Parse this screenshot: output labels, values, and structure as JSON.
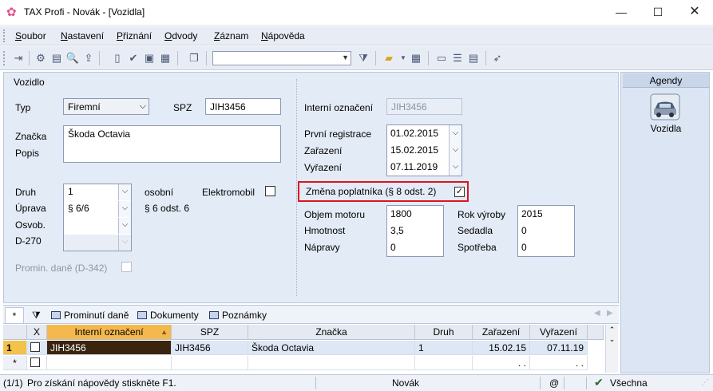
{
  "window": {
    "title": "TAX Profi - Novák - [Vozidla]",
    "icon": "flower-app-icon",
    "controls": [
      "minimize-icon",
      "maximize-icon",
      "close-icon"
    ]
  },
  "menu": [
    {
      "label": "Soubor",
      "mnemonic": "S",
      "rest": "oubor"
    },
    {
      "label": "Nastavení",
      "mnemonic": "N",
      "rest": "astavení"
    },
    {
      "label": "Přiznání",
      "mnemonic": "P",
      "rest": "řiznání"
    },
    {
      "label": "Odvody",
      "mnemonic": "O",
      "rest": "dvody"
    },
    {
      "label": "Záznam",
      "mnemonic": "Z",
      "rest": "áznam"
    },
    {
      "label": "Nápověda",
      "mnemonic": "N",
      "rest": "ápověda"
    }
  ],
  "toolbar": {
    "search_value": ""
  },
  "form": {
    "section_title": "Vozidlo",
    "typ_label": "Typ",
    "typ_value": "Firemní",
    "spz_label": "SPZ",
    "spz_value": "JIH3456",
    "znacka_label": "Značka",
    "znacka_value": "Škoda Octavia",
    "popis_label": "Popis",
    "druh_label": "Druh",
    "druh_value": "1",
    "druh_desc": "osobní",
    "uprava_label": "Úprava",
    "uprava_value": "§ 6/6",
    "uprava_desc": "§ 6 odst. 6",
    "osvob_label": "Osvob.",
    "osvob_value": "",
    "d270_label": "D-270",
    "d270_value": "",
    "elektromobil_label": "Elektromobil",
    "elektromobil_checked": false,
    "promin_label": "Promin. daně (D-342)",
    "promin_checked": false,
    "interni_label": "Interní označení",
    "interni_value": "JIH3456",
    "prvni_reg_label": "První registrace",
    "prvni_reg_value": "01.02.2015",
    "zarazeni_label": "Zařazení",
    "zarazeni_value": "15.02.2015",
    "vyrazeni_label": "Vyřazení",
    "vyrazeni_value": "07.11.2019",
    "zmena_label": "Změna poplatníka (§ 8 odst. 2)",
    "zmena_checked": true,
    "zmena_mark": "✓",
    "objem_label": "Objem motoru",
    "objem_value": "1800",
    "hmotnost_label": "Hmotnost",
    "hmotnost_value": "3,5",
    "napravy_label": "Nápravy",
    "napravy_value": "0",
    "rok_label": "Rok výroby",
    "rok_value": "2015",
    "sedadla_label": "Sedadla",
    "sedadla_value": "0",
    "spotreba_label": "Spotřeba",
    "spotreba_value": "0",
    "highlight_color": "#e0141e"
  },
  "agendy": {
    "header": "Agendy",
    "items": [
      {
        "label": "Vozidla",
        "icon": "car-icon"
      }
    ]
  },
  "tabs": {
    "star": "*",
    "items": [
      "Prominutí daně",
      "Dokumenty",
      "Poznámky"
    ]
  },
  "grid": {
    "columns": [
      "X",
      "Interní označení",
      "SPZ",
      "Značka",
      "Druh",
      "Zařazení",
      "Vyřazení"
    ],
    "rows": [
      {
        "num": "1",
        "x": "",
        "interni": "JIH3456",
        "spz": "JIH3456",
        "znacka": "Škoda Octavia",
        "druh": "1",
        "zarazeni": "15.02.15",
        "vyrazeni": "07.11.19"
      }
    ],
    "new_row_marker": "*",
    "new_row_dots": ". .",
    "new_row_dots2": ". ."
  },
  "status": {
    "record": "(1/1)",
    "hint": "Pro získání nápovědy stiskněte F1.",
    "user": "Novák",
    "at": "@",
    "filter": "Všechna"
  }
}
